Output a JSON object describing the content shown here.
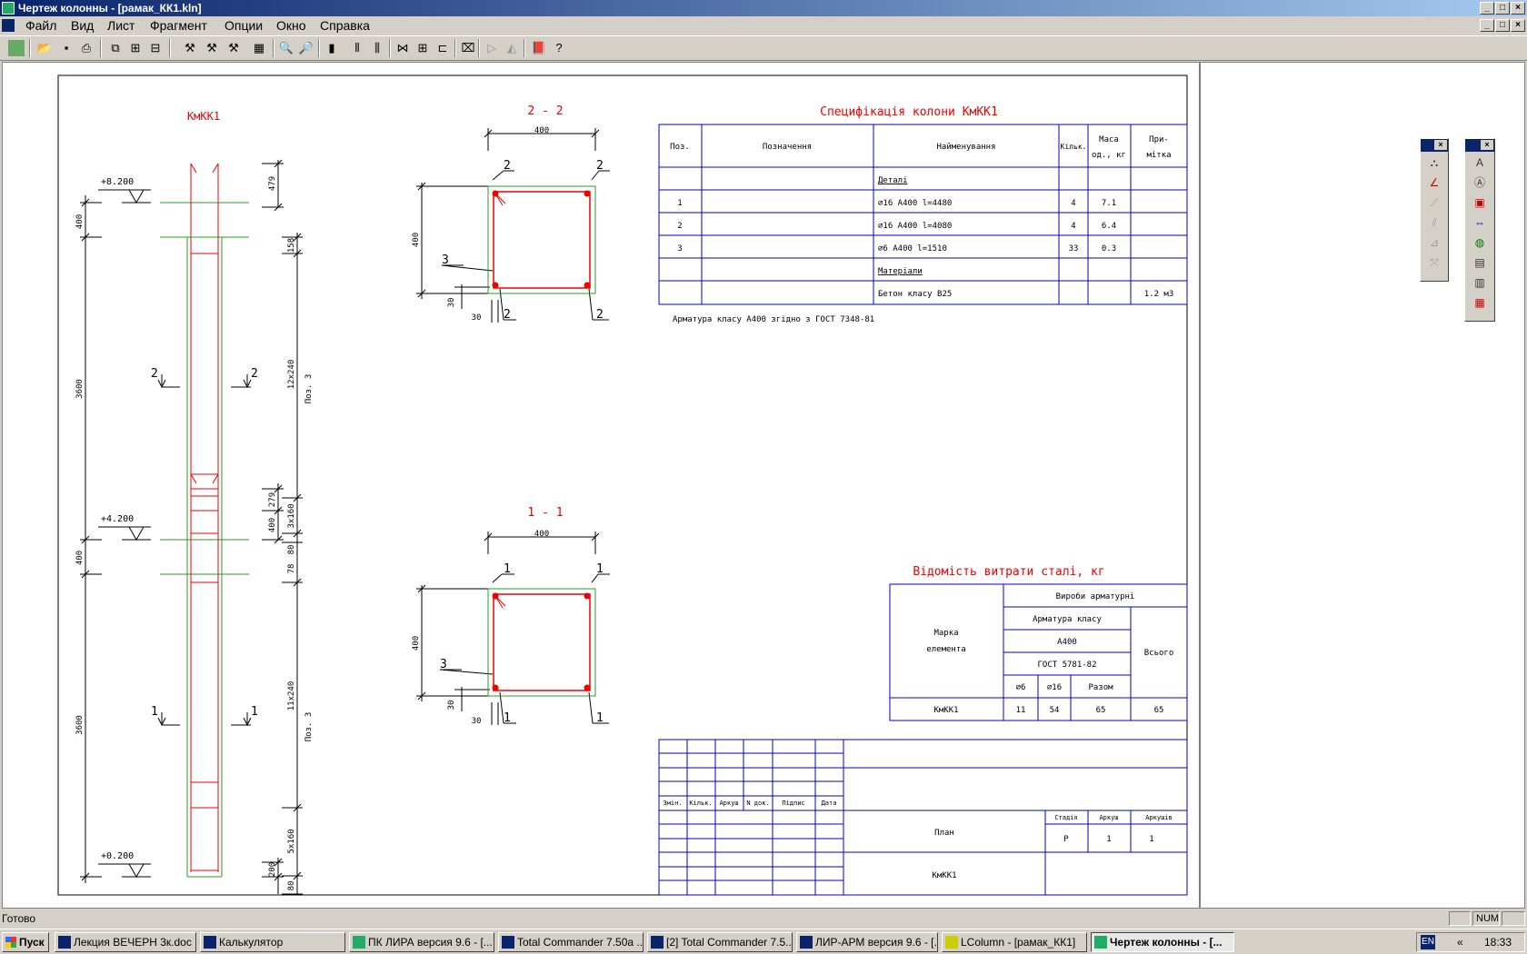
{
  "window": {
    "title": "Чертеж колонны - [рамак_КК1.kln]"
  },
  "menu": [
    "Файл",
    "Вид",
    "Лист",
    "Фрагмент",
    "Опции",
    "Окно",
    "Справка"
  ],
  "drawing": {
    "column_title": "КмКК1",
    "section_22_title": "2 - 2",
    "section_11_title": "1 - 1",
    "levels": [
      "+8.200",
      "+4.200",
      "+0.200"
    ],
    "left_dims": [
      "400",
      "3600",
      "400",
      "3600"
    ],
    "right_dims": [
      "479",
      "158",
      "12x240",
      "279",
      "400",
      "3x160",
      "80",
      "78",
      "11x240",
      "5x160",
      "200",
      "80"
    ],
    "pos_label": "Поз. 3",
    "section_marks": {
      "two": "2",
      "one": "1",
      "three": "3"
    },
    "sec_dims": {
      "width": "400",
      "height": "400",
      "cover_v": "30",
      "cover_h": "30"
    }
  },
  "spec": {
    "title": "Специфікація колони КмКК1",
    "headers": [
      "Поз.",
      "Позначення",
      "Найменування",
      "Кільк.",
      "Маса од., кг",
      "При-мітка"
    ],
    "header_mass": [
      "Маса",
      "од., кг"
    ],
    "header_note": [
      "При-",
      "мітка"
    ],
    "rows": [
      {
        "pos": "",
        "des": "",
        "name": "Деталі",
        "qty": "",
        "mass": "",
        "note": ""
      },
      {
        "pos": "1",
        "des": "",
        "name": "∅16 А400 l=4480",
        "qty": "4",
        "mass": "7.1",
        "note": ""
      },
      {
        "pos": "2",
        "des": "",
        "name": "∅16 А400 l=4080",
        "qty": "4",
        "mass": "6.4",
        "note": ""
      },
      {
        "pos": "3",
        "des": "",
        "name": "∅6 А400 l=1510",
        "qty": "33",
        "mass": "0.3",
        "note": ""
      },
      {
        "pos": "",
        "des": "",
        "name": "Матеріали",
        "qty": "",
        "mass": "",
        "note": ""
      },
      {
        "pos": "",
        "des": "",
        "name": "Бетон класу В25",
        "qty": "",
        "mass": "",
        "note": "1.2 м3"
      }
    ],
    "note": "Арматура класу А400 згідно з ГОСТ 7348-81"
  },
  "steel": {
    "title": "Відомість витрати сталі, кг",
    "mark_label": [
      "Марка",
      "елемента"
    ],
    "products": "Вироби арматурні",
    "class_label": "Арматура класу",
    "class": "А400",
    "gost": "ГОСТ 5781-82",
    "d6": "∅6",
    "d16": "∅16",
    "sum": "Разом",
    "total": "Всього",
    "row": {
      "mark": "КмКК1",
      "d6": "11",
      "d16": "54",
      "sum": "65",
      "total": "65"
    }
  },
  "stamp": {
    "cols": [
      "Змін.",
      "Кільк.",
      "Аркуш",
      "N док.",
      "Підпис",
      "Дата"
    ],
    "stage_h": "Стадія",
    "sheet_h": "Аркуш",
    "sheets_h": "Аркушів",
    "stage": "Р",
    "sheet": "1",
    "sheets": "1",
    "plan": "План",
    "mark": "КмКК1"
  },
  "status": {
    "text": "Готово",
    "num": "NUM"
  },
  "taskbar": {
    "start": "Пуск",
    "tasks": [
      "Лекция ВЕЧЕРН 3к.doc ...",
      "Калькулятор",
      "ПК ЛИРА версия 9.6 - [...",
      "Total Commander 7.50a ...",
      "[2] Total Commander 7.5...",
      "ЛИР-АРМ версия 9.6 - [...",
      "LColumn - [рамак_КК1]",
      "Чертеж колонны - [..."
    ],
    "lang": "EN",
    "clock": "18:33"
  }
}
